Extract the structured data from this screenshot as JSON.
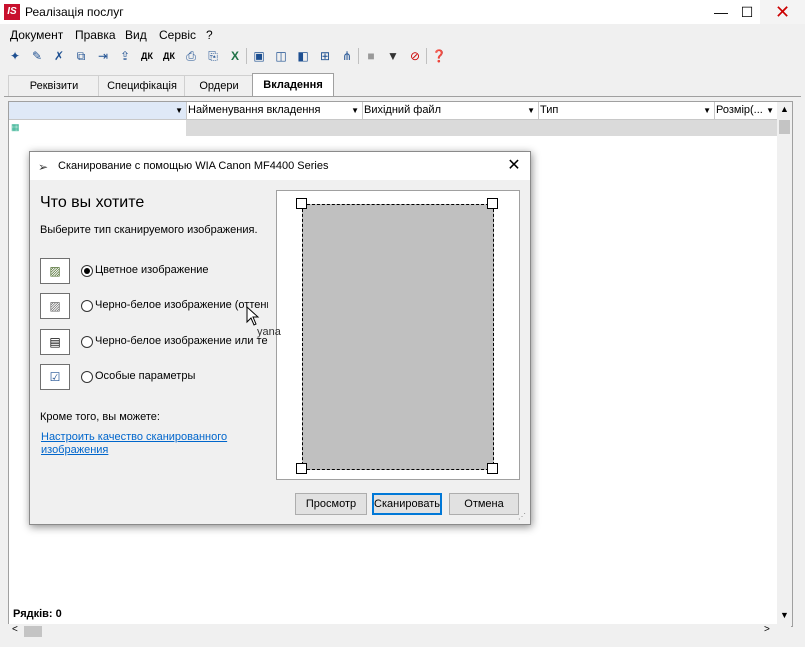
{
  "window": {
    "title": "Реалізація послуг",
    "logo": "IS",
    "min_glyph": "—",
    "max_glyph": "☐",
    "close_glyph": "✕"
  },
  "menu": [
    "Документ",
    "Правка",
    "Вид",
    "Сервіс",
    "?"
  ],
  "toolbar_icons": [
    "new-doc-icon",
    "create-icon",
    "delete-icon",
    "copy-icon",
    "move-icon",
    "upload-icon",
    "debit-credit-icon",
    "debit-credit-2-icon",
    "print-icon",
    "print-preview-icon",
    "excel-icon",
    "save-icon",
    "open-book-icon",
    "columns-icon",
    "link-icon",
    "tree-icon",
    "gray-block-icon",
    "filter-icon",
    "clear-filter-icon",
    "help-icon"
  ],
  "tabs": [
    {
      "label": "Реквізити",
      "active": false
    },
    {
      "label": "Специфікація",
      "active": false
    },
    {
      "label": "Ордери",
      "active": false
    },
    {
      "label": "Вкладення",
      "active": true
    }
  ],
  "grid": {
    "columns": [
      "",
      "Найменування вкладення",
      "Вихідний файл",
      "Тип",
      "Розмір(..."
    ],
    "rows_count_label": "Рядків: 0"
  },
  "dialog": {
    "title": "Сканирование с помощью WIA Canon MF4400 Series",
    "heading": "Что вы хотите",
    "subheading": "Выберите тип сканируемого изображения.",
    "options": [
      {
        "label": "Цветное изображение",
        "selected": true,
        "icon": "color-photo-icon"
      },
      {
        "label": "Черно-белое изображение (оттенки серого)",
        "selected": false,
        "icon": "grayscale-photo-icon"
      },
      {
        "label": "Черно-белое изображение или текст",
        "selected": false,
        "icon": "text-document-icon"
      },
      {
        "label": "Особые параметры",
        "selected": false,
        "icon": "custom-settings-icon"
      }
    ],
    "also_label": "Кроме того, вы можете:",
    "quality_link": "Настроить качество сканированного изображения",
    "buttons": {
      "preview": "Просмотр",
      "scan": "Сканировать",
      "cancel": "Отмена"
    }
  },
  "cursor_tooltip": "yana",
  "colors": {
    "preview_fill": "#c0c0c0",
    "link": "#0066cc",
    "accent": "#0078d7"
  }
}
